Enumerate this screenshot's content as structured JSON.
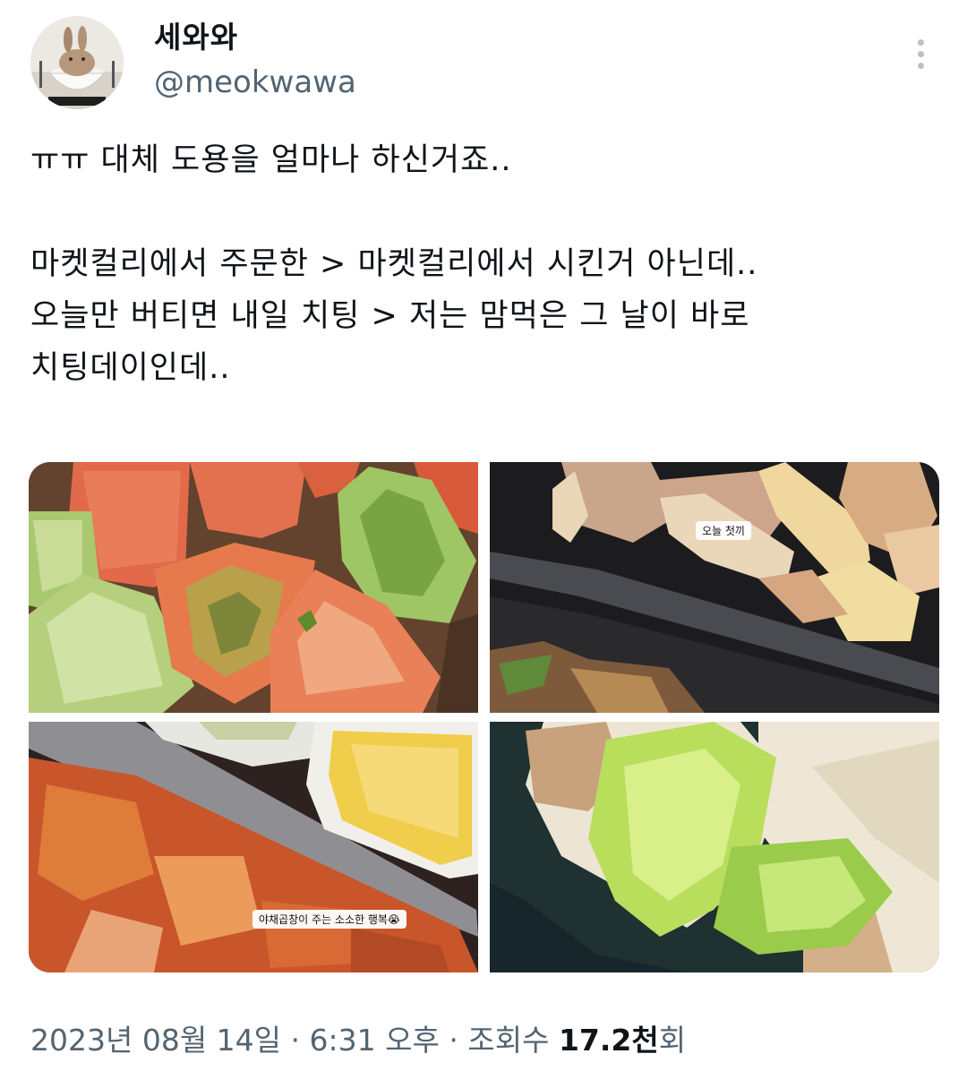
{
  "author": {
    "display_name": "세와와",
    "handle": "@meokwawa",
    "avatar_icon": "bunny-in-bowl-avatar"
  },
  "more_icon": "more-vertical-icon",
  "tweet": {
    "line1": "ㅠㅠ 대체 도용을 얼마나 하신거죠..",
    "line2": "마켓컬리에서 주문한 > 마켓컬리에서 시킨거 아닌데..",
    "line3": "오늘만 버티면 내일 치팅 > 저는 맘먹은 그 날이 바로",
    "line4": "치팅데이인데.."
  },
  "media": {
    "photos": [
      {
        "subject": "tomatoes-photo"
      },
      {
        "subject": "chicken-tteok-photo",
        "caption": "오늘 첫끼"
      },
      {
        "subject": "tripe-corn-photo",
        "caption": "야채곱창이 주는 소소한 행복😭"
      },
      {
        "subject": "tortilla-wrap-photo"
      }
    ]
  },
  "meta": {
    "date": "2023년 08월 14일",
    "sep1": "·",
    "time": "6:31 오후",
    "sep2": "·",
    "views_label": "조회수",
    "views_count": "17.2천",
    "views_suffix": "회"
  }
}
